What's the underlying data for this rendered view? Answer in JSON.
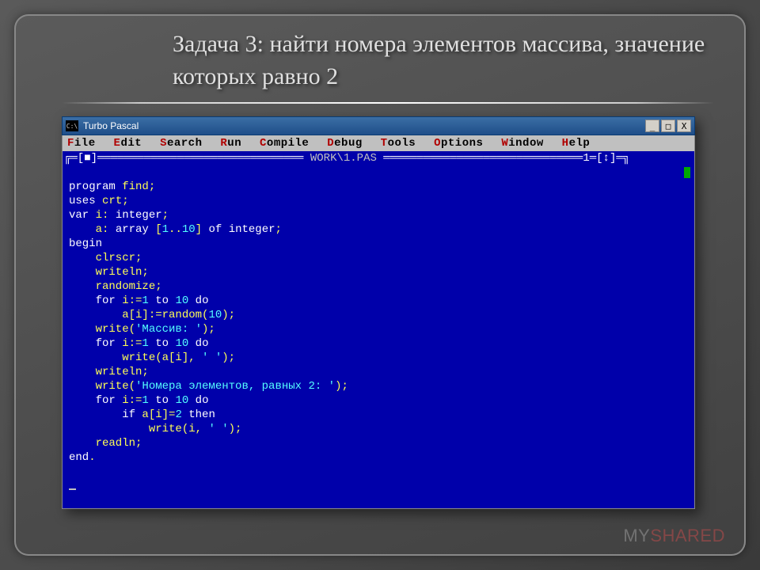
{
  "slide": {
    "title": "Задача 3: найти номера элементов массива, значение которых равно 2"
  },
  "window": {
    "icon_label": "C:\\",
    "title": "Turbo Pascal",
    "buttons": {
      "min": "_",
      "max": "□",
      "close": "X"
    }
  },
  "menu": [
    {
      "hot": "F",
      "rest": "ile"
    },
    {
      "hot": "E",
      "rest": "dit"
    },
    {
      "hot": "S",
      "rest": "earch"
    },
    {
      "hot": "R",
      "rest": "un"
    },
    {
      "hot": "C",
      "rest": "ompile"
    },
    {
      "hot": "D",
      "rest": "ebug"
    },
    {
      "hot": "T",
      "rest": "ools"
    },
    {
      "hot": "O",
      "rest": "ptions"
    },
    {
      "hot": "W",
      "rest": "indow"
    },
    {
      "hot": "H",
      "rest": "elp"
    }
  ],
  "editor": {
    "frame_left": "╔═[■]═",
    "frame_fill": "═",
    "file_label": " WORK\\1.PAS ",
    "frame_right": "1═[↕]═╗"
  },
  "code": {
    "l01_a": "program",
    "l01_b": " find",
    "l01_c": ";",
    "l02_a": "uses",
    "l02_b": " crt",
    "l02_c": ";",
    "l03_a": "var",
    "l03_b": " i: ",
    "l03_c": "integer",
    "l03_d": ";",
    "l04_a": "    a: ",
    "l04_b": "array",
    "l04_c": " [",
    "l04_d": "1",
    "l04_e": "..",
    "l04_f": "10",
    "l04_g": "] ",
    "l04_h": "of",
    "l04_i": " ",
    "l04_j": "integer",
    "l04_k": ";",
    "l05": "begin",
    "l06": "    clrscr;",
    "l07": "    writeln;",
    "l08": "    randomize;",
    "l09_a": "    for",
    "l09_b": " i:=",
    "l09_c": "1",
    "l09_d": " to",
    "l09_e": " ",
    "l09_f": "10",
    "l09_g": " do",
    "l10_a": "        a[i]:=random(",
    "l10_b": "10",
    "l10_c": ");",
    "l11_a": "    write(",
    "l11_b": "'Массив: '",
    "l11_c": ");",
    "l12_a": "    for",
    "l12_b": " i:=",
    "l12_c": "1",
    "l12_d": " to",
    "l12_e": " ",
    "l12_f": "10",
    "l12_g": " do",
    "l13_a": "        write(a[i], ",
    "l13_b": "' '",
    "l13_c": ");",
    "l14": "    writeln;",
    "l15_a": "    write(",
    "l15_b": "'Номера элементов, равных 2: '",
    "l15_c": ");",
    "l16_a": "    for",
    "l16_b": " i:=",
    "l16_c": "1",
    "l16_d": " to",
    "l16_e": " ",
    "l16_f": "10",
    "l16_g": " do",
    "l17_a": "        if",
    "l17_b": " a[i]=",
    "l17_c": "2",
    "l17_d": " then",
    "l18_a": "            write(i, ",
    "l18_b": "' '",
    "l18_c": ");",
    "l19": "    readln;",
    "l20_a": "end",
    "l20_b": "."
  },
  "watermark": {
    "pre": "MY",
    "red": "SHARED"
  }
}
